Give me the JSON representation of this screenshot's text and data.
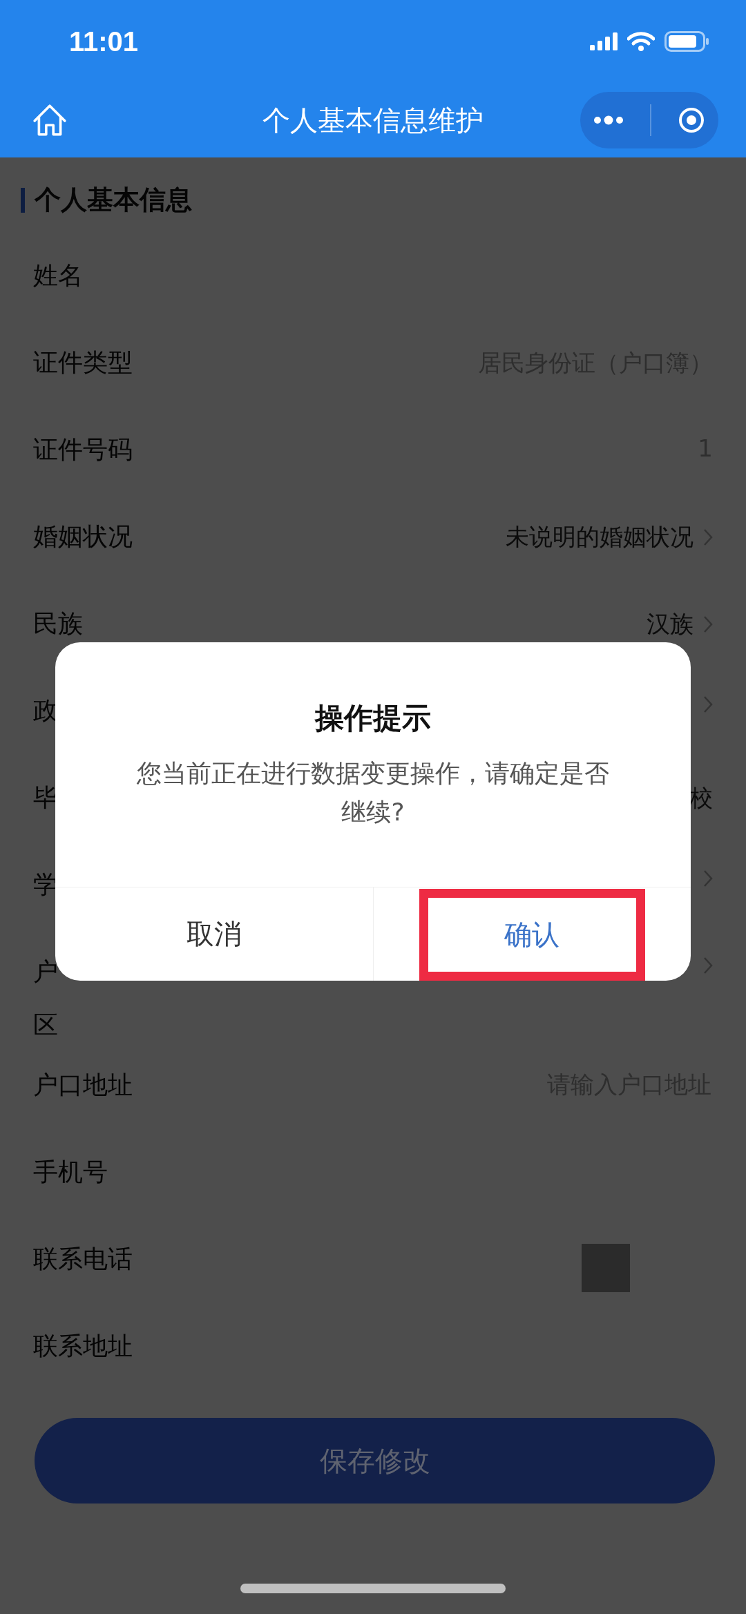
{
  "status_bar": {
    "time": "11:01"
  },
  "nav_bar": {
    "title": "个人基本信息维护"
  },
  "section": {
    "title": "个人基本信息"
  },
  "rows": [
    {
      "label": [
        "姓名"
      ]
    },
    {
      "label": [
        "证件类型"
      ],
      "value": "居民身份证（户口簿）"
    },
    {
      "label": [
        "证件号码"
      ],
      "value": "1"
    },
    {
      "label": [
        "婚姻状况"
      ],
      "value": "未说明的婚姻状况",
      "chevron": true
    },
    {
      "label": [
        "民族"
      ],
      "value": "汉族",
      "chevron": true
    },
    {
      "label": [
        "政"
      ],
      "chevron": true
    },
    {
      "label": [
        "毕"
      ],
      "value": "校"
    },
    {
      "label": [
        "学"
      ],
      "chevron": true
    },
    {
      "label": [
        "户",
        "区"
      ],
      "chevron": true
    },
    {
      "label": [
        "户口地址"
      ],
      "placeholder": "请输入户口地址"
    },
    {
      "label": [
        "手机号"
      ]
    },
    {
      "label": [
        "联系电话"
      ],
      "redacted": true
    },
    {
      "label": [
        "联系地址"
      ]
    }
  ],
  "save_button": {
    "label": "保存修改"
  },
  "dialog": {
    "title": "操作提示",
    "message": "您当前正在进行数据变更操作，请确定是否继续?",
    "buttons": [
      {
        "label": "取消",
        "kind": "cancel",
        "highlighted": false
      },
      {
        "label": "确认",
        "kind": "confirm",
        "highlighted": true
      }
    ]
  }
}
